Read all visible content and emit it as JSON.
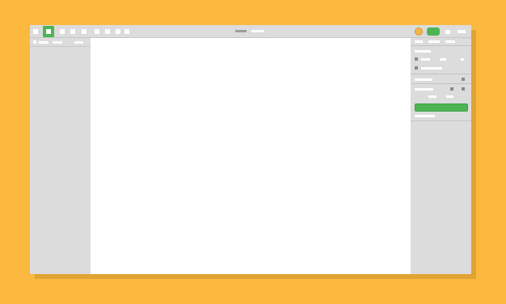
{
  "window": {
    "background": "#ffffff",
    "accent": "#4cb551"
  },
  "toolbar": {
    "tools": [
      "select-tool-icon",
      "frame-tool-icon",
      "shape-tool-icon",
      "pen-tool-icon",
      "text-tool-icon",
      "hand-tool-icon",
      "comment-tool-icon"
    ],
    "active_tool": "frame-tool-icon",
    "collaborator_color": "#f3b64b",
    "share_color": "#4cb551"
  },
  "colors": {
    "page_background": "#fbb940",
    "panel": "#dcdcdc",
    "primary_button": "#4cb551"
  }
}
